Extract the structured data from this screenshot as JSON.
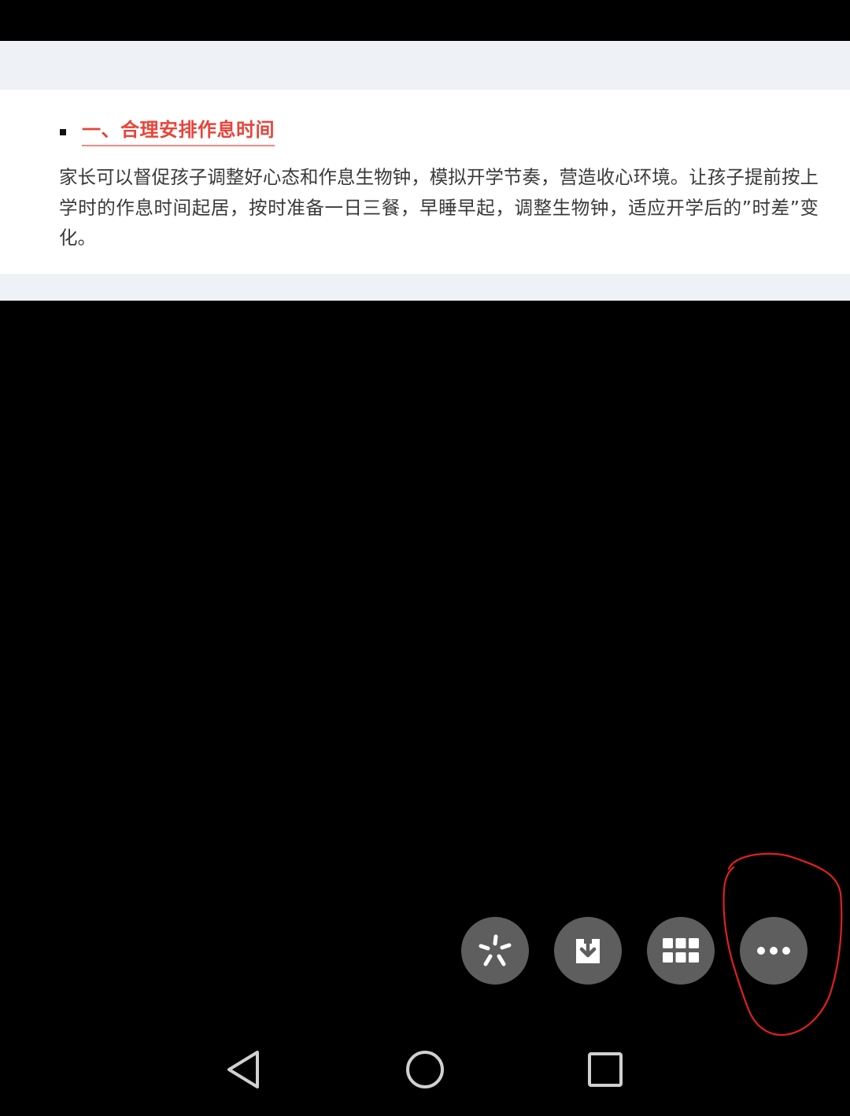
{
  "article": {
    "heading": "一、合理安排作息时间",
    "paragraph": "家长可以督促孩子调整好心态和作息生物钟，模拟开学节奏，营造收心环境。让孩子提前按上学时的作息时间起居，按时准备一日三餐，早睡早起，调整生物钟，适应开学后的”时差”变化。"
  },
  "actions": [
    {
      "name": "share",
      "icon": "pinwheel-icon"
    },
    {
      "name": "save",
      "icon": "download-icon"
    },
    {
      "name": "apps",
      "icon": "grid-icon"
    },
    {
      "name": "more",
      "icon": "more-dots-icon"
    }
  ],
  "navigation": {
    "back_icon": "back-triangle-icon",
    "home_icon": "home-circle-icon",
    "recents_icon": "recents-square-icon"
  },
  "colors": {
    "heading": "#e8443a",
    "button_bg": "#5e5e5e",
    "annotation": "#e02020",
    "background": "#000000"
  }
}
